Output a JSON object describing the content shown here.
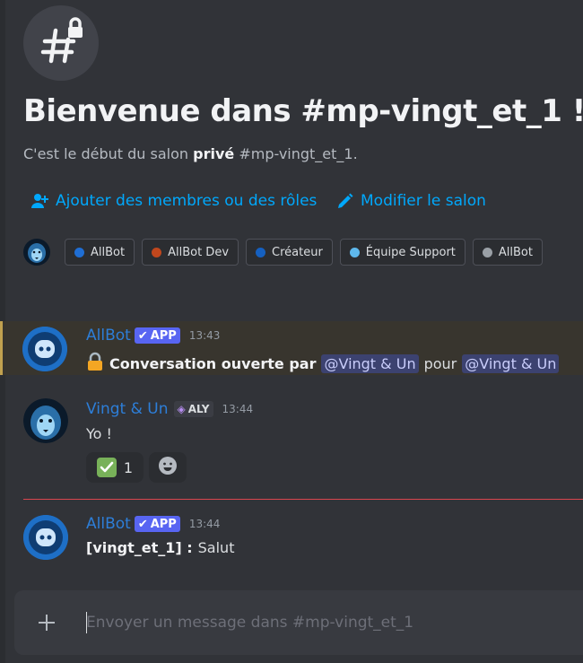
{
  "channel": {
    "icon": "hashtag-lock-icon",
    "welcome_title": "Bienvenue dans #mp-vingt_et_1 !",
    "intro_prefix": "C'est le début du salon ",
    "intro_bold": "privé",
    "intro_suffix": " #mp-vingt_et_1."
  },
  "actions": {
    "add_members": "Ajouter des membres ou des rôles",
    "edit_channel": "Modifier le salon",
    "accent_color": "#00a8fc"
  },
  "roles": [
    {
      "label": "AllBot",
      "color": "#1f6ed4"
    },
    {
      "label": "AllBot Dev",
      "color": "#c0471d"
    },
    {
      "label": "Créateur",
      "color": "#1560c0"
    },
    {
      "label": "Équipe Support",
      "color": "#5eb8ec"
    },
    {
      "label": "AllBot",
      "color": "#9aa0a6"
    }
  ],
  "messages": [
    {
      "author": "AllBot",
      "badge": "APP",
      "time": "13:43",
      "emoji": "lock",
      "text_bold": "Conversation ouverte par",
      "mention1": "@Vingt & Un",
      "connector": "pour",
      "mention2": "@Vingt & Un",
      "highlighted": true
    },
    {
      "author": "Vingt & Un",
      "tag": "ALY",
      "time": "13:44",
      "text": "Yo !",
      "reactions": [
        {
          "emoji": "white-check-mark",
          "count": "1"
        }
      ],
      "add_reaction": "add-reaction-icon"
    },
    {
      "author": "AllBot",
      "badge": "APP",
      "time": "13:44",
      "text_bold": "[vingt_et_1] :",
      "text": "Salut"
    }
  ],
  "composer": {
    "placeholder": "Envoyer un message dans #mp-vingt_et_1",
    "value": ""
  },
  "colors": {
    "background": "#313338",
    "username": "#2d7ed8",
    "app_badge": "#5865f2",
    "new_messages_divider": "#d9464f",
    "highlight_bar": "#c1a14f"
  }
}
